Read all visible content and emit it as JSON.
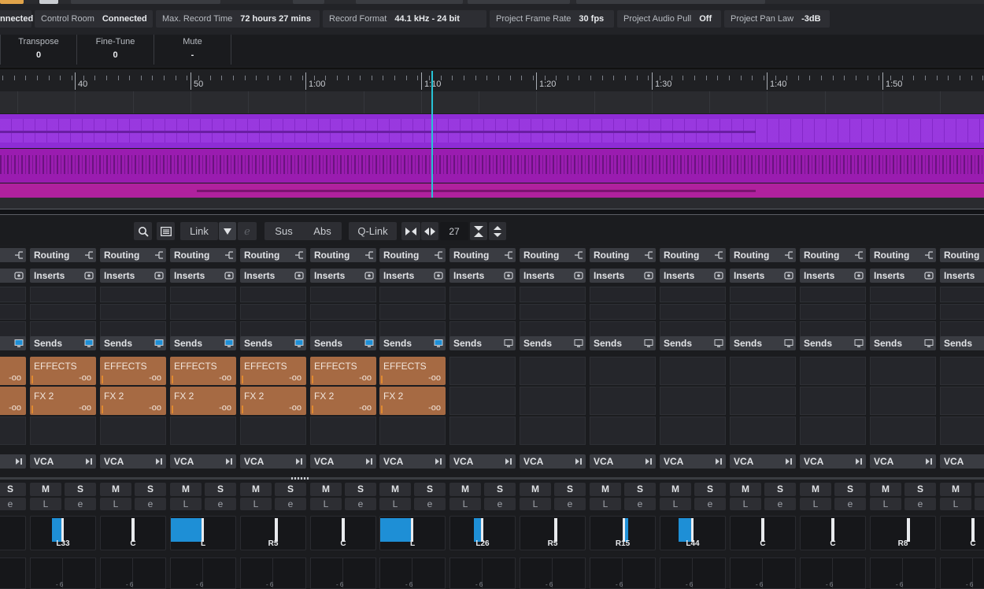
{
  "status_bar": {
    "items": [
      {
        "label": "",
        "value": "nnected"
      },
      {
        "label": "Control Room",
        "value": "Connected"
      },
      {
        "label": "Max. Record Time",
        "value": "72 hours 27 mins"
      },
      {
        "label": "Record Format",
        "value": "44.1 kHz - 24 bit"
      },
      {
        "label": "Project Frame Rate",
        "value": "30 fps"
      },
      {
        "label": "Project Audio Pull",
        "value": "Off"
      },
      {
        "label": "Project Pan Law",
        "value": "-3dB"
      }
    ]
  },
  "info_line": [
    {
      "label": "Transpose",
      "value": "0"
    },
    {
      "label": "Fine-Tune",
      "value": "0"
    },
    {
      "label": "Mute",
      "value": "-"
    }
  ],
  "ruler": {
    "labels": [
      "40",
      "50",
      "1:00",
      "1:10",
      "1:20",
      "1:30",
      "1:40",
      "1:50"
    ]
  },
  "toolbar": {
    "search_icon": "search-icon",
    "list_icon": "list-icon",
    "link_label": "Link",
    "sus_label": "Sus",
    "abs_label": "Abs",
    "qlink_label": "Q-Link",
    "channel_count": "27"
  },
  "labels": {
    "routing": "Routing",
    "inserts": "Inserts",
    "sends": "Sends",
    "vca": "VCA",
    "mute": "M",
    "solo": "S",
    "listen": "L",
    "edit": "e",
    "fader_val": "- 6"
  },
  "colors": {
    "accent_blue": "#1e8fd6",
    "send_brown": "#a66a43",
    "playhead": "#27c3d6",
    "track_purple": "#8e2cd6",
    "track_magenta": "#b0219e"
  },
  "strips": [
    {
      "sends": [
        {
          "name": "",
          "value": "-oo"
        },
        {
          "name": "",
          "value": "-oo"
        }
      ],
      "pan": {
        "label": "",
        "mode": "fill",
        "from": 0.0,
        "to": 0.35
      }
    },
    {
      "sends": [
        {
          "name": "EFFECTS",
          "value": "-oo"
        },
        {
          "name": "FX 2",
          "value": "-oo"
        }
      ],
      "pan": {
        "label": "L33",
        "mode": "fill",
        "from": 0.33,
        "to": 0.5
      }
    },
    {
      "sends": [
        {
          "name": "EFFECTS",
          "value": "-oo"
        },
        {
          "name": "FX 2",
          "value": "-oo"
        }
      ],
      "pan": {
        "label": "C",
        "mode": "center",
        "from": 0.5,
        "to": 0.5
      }
    },
    {
      "sends": [
        {
          "name": "EFFECTS",
          "value": "-oo"
        },
        {
          "name": "FX 2",
          "value": "-oo"
        }
      ],
      "pan": {
        "label": "L",
        "mode": "fill",
        "from": 0.0,
        "to": 0.5
      }
    },
    {
      "sends": [
        {
          "name": "EFFECTS",
          "value": "-oo"
        },
        {
          "name": "FX 2",
          "value": "-oo"
        }
      ],
      "pan": {
        "label": "R5",
        "mode": "center",
        "from": 0.55,
        "to": 0.55
      }
    },
    {
      "sends": [
        {
          "name": "EFFECTS",
          "value": "-oo"
        },
        {
          "name": "FX 2",
          "value": "-oo"
        }
      ],
      "pan": {
        "label": "C",
        "mode": "center",
        "from": 0.5,
        "to": 0.5
      }
    },
    {
      "sends": [
        {
          "name": "EFFECTS",
          "value": "-oo"
        },
        {
          "name": "FX 2",
          "value": "-oo"
        }
      ],
      "pan": {
        "label": "L",
        "mode": "fill",
        "from": 0.0,
        "to": 0.5
      }
    },
    {
      "sends": [],
      "pan": {
        "label": "L26",
        "mode": "fill",
        "from": 0.37,
        "to": 0.5
      }
    },
    {
      "sends": [],
      "pan": {
        "label": "R5",
        "mode": "center",
        "from": 0.55,
        "to": 0.55
      }
    },
    {
      "sends": [],
      "pan": {
        "label": "R15",
        "mode": "fill",
        "from": 0.5,
        "to": 0.58
      }
    },
    {
      "sends": [],
      "pan": {
        "label": "L44",
        "mode": "fill",
        "from": 0.28,
        "to": 0.5
      }
    },
    {
      "sends": [],
      "pan": {
        "label": "C",
        "mode": "center",
        "from": 0.5,
        "to": 0.5
      }
    },
    {
      "sends": [],
      "pan": {
        "label": "C",
        "mode": "center",
        "from": 0.5,
        "to": 0.5
      }
    },
    {
      "sends": [],
      "pan": {
        "label": "R8",
        "mode": "center",
        "from": 0.58,
        "to": 0.58
      }
    },
    {
      "sends": [],
      "pan": {
        "label": "C",
        "mode": "center",
        "from": 0.5,
        "to": 0.5
      }
    }
  ]
}
